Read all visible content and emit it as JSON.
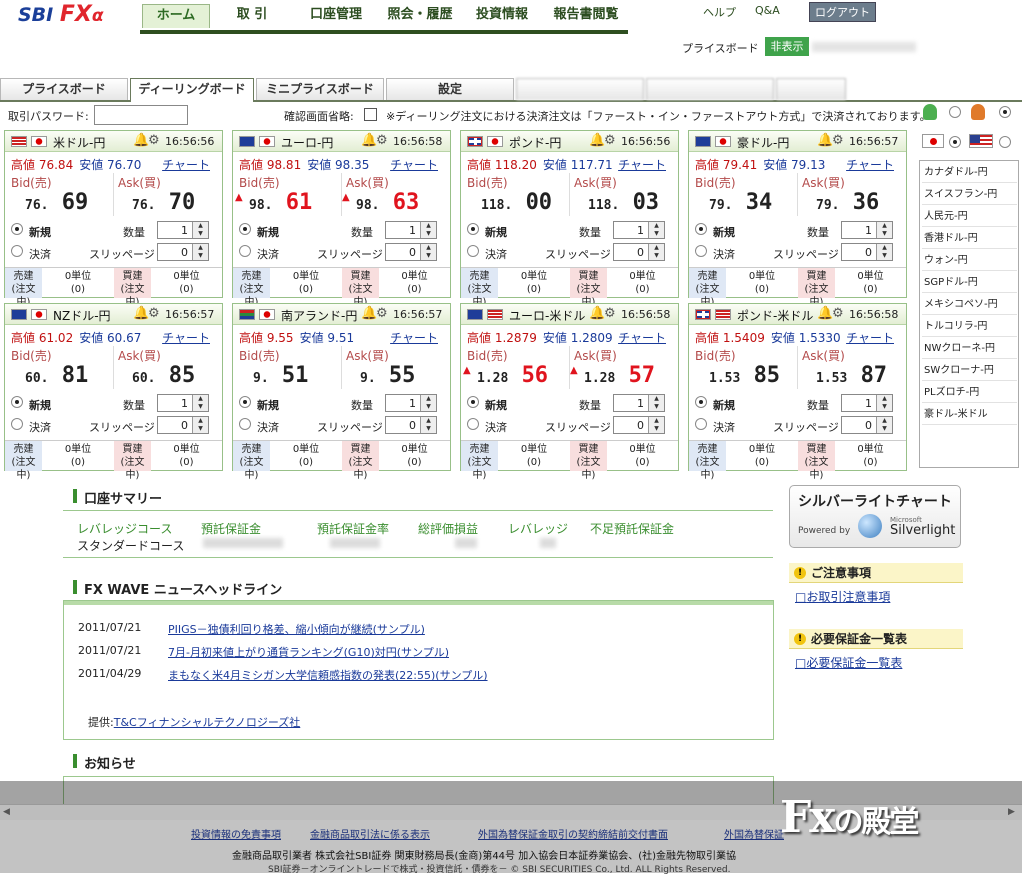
{
  "app": {
    "logo_sbi": "SBI",
    "logo_fx": "FX",
    "logo_alpha": "α"
  },
  "nav": {
    "items": [
      "ホーム",
      "取 引",
      "口座管理",
      "照会・履歴",
      "投資情報",
      "報告書閲覧"
    ],
    "help": "ヘルプ",
    "qa": "Q&A",
    "logout": "ログアウト"
  },
  "priceboard": {
    "label": "プライスボード",
    "hide": "非表示"
  },
  "tabs": [
    "プライスボード",
    "ディーリングボード",
    "ミニプライスボード",
    "設定"
  ],
  "form": {
    "password_label": "取引パスワード:",
    "confirm_label": "確認画面省略:",
    "note": "※ディーリング注文における決済注文は「ファースト・イン・ファーストアウト方式」で決済されております。"
  },
  "labels": {
    "high": "高値",
    "low": "安値",
    "chart": "チャート",
    "bid": "Bid(売)",
    "ask": "Ask(買)",
    "new": "新規",
    "settle": "決済",
    "qty": "数量",
    "slip": "スリッページ",
    "sell_pos": "売建",
    "buy_pos": "買建",
    "ordering": "(注文中)",
    "zero_unit": "0単位",
    "zero_paren": "(0)"
  },
  "panels": [
    {
      "pair": "米ドル-円",
      "time": "16:56:56",
      "high": "76.84",
      "low": "76.70",
      "bid_pre": "76.",
      "bid_big": "69",
      "ask_pre": "76.",
      "ask_big": "70",
      "up": false,
      "qty": "1",
      "slip": "0",
      "flags": [
        "us",
        "jp"
      ]
    },
    {
      "pair": "ユーロ-円",
      "time": "16:56:58",
      "high": "98.81",
      "low": "98.35",
      "bid_pre": "98.",
      "bid_big": "61",
      "ask_pre": "98.",
      "ask_big": "63",
      "up": true,
      "qty": "1",
      "slip": "0",
      "flags": [
        "eu",
        "jp"
      ]
    },
    {
      "pair": "ポンド-円",
      "time": "16:56:56",
      "high": "118.20",
      "low": "117.71",
      "bid_pre": "118.",
      "bid_big": "00",
      "ask_pre": "118.",
      "ask_big": "03",
      "up": false,
      "qty": "1",
      "slip": "0",
      "flags": [
        "gb",
        "jp"
      ]
    },
    {
      "pair": "豪ドル-円",
      "time": "16:56:57",
      "high": "79.41",
      "low": "79.13",
      "bid_pre": "79.",
      "bid_big": "34",
      "ask_pre": "79.",
      "ask_big": "36",
      "up": false,
      "qty": "1",
      "slip": "0",
      "flags": [
        "au",
        "jp"
      ]
    },
    {
      "pair": "NZドル-円",
      "time": "16:56:57",
      "high": "61.02",
      "low": "60.67",
      "bid_pre": "60.",
      "bid_big": "81",
      "ask_pre": "60.",
      "ask_big": "85",
      "up": false,
      "qty": "1",
      "slip": "0",
      "flags": [
        "nz",
        "jp"
      ]
    },
    {
      "pair": "南アランド-円",
      "time": "16:56:57",
      "high": "9.55",
      "low": "9.51",
      "bid_pre": "9.",
      "bid_big": "51",
      "ask_pre": "9.",
      "ask_big": "55",
      "up": false,
      "qty": "1",
      "slip": "0",
      "flags": [
        "za",
        "jp"
      ]
    },
    {
      "pair": "ユーロ-米ドル",
      "time": "16:56:58",
      "high": "1.2879",
      "low": "1.2809",
      "bid_pre": "1.28",
      "bid_big": "56",
      "ask_pre": "1.28",
      "ask_big": "57",
      "up": true,
      "qty": "1",
      "slip": "0",
      "flags": [
        "eu",
        "us"
      ]
    },
    {
      "pair": "ポンド-米ドル",
      "time": "16:56:58",
      "high": "1.5409",
      "low": "1.5330",
      "bid_pre": "1.53",
      "bid_big": "85",
      "ask_pre": "1.53",
      "ask_big": "87",
      "up": false,
      "qty": "1",
      "slip": "0",
      "flags": [
        "gb",
        "us"
      ]
    }
  ],
  "side_list": [
    "カナダドル-円",
    "スイスフラン-円",
    "人民元-円",
    "香港ドル-円",
    "ウォン-円",
    "SGPドル-円",
    "メキシコペソ-円",
    "トルコリラ-円",
    "NWクローネ-円",
    "SWクローナ-円",
    "PLズロチ-円",
    "豪ドル-米ドル"
  ],
  "account": {
    "title": "口座サマリー",
    "cols": [
      "レバレッジコース",
      "預託保証金",
      "預託保証金率",
      "総評価損益",
      "レバレッジ",
      "不足預託保証金"
    ],
    "course": "スタンダードコース"
  },
  "news": {
    "title": "FX WAVE ニュースヘッドライン",
    "items": [
      {
        "date": "2011/07/21",
        "text": "PIIGS－独債利回り格差、縮小傾向が継続(サンプル)"
      },
      {
        "date": "2011/07/21",
        "text": "7月-月初来値上がり通貨ランキング(G10)対円(サンプル)"
      },
      {
        "date": "2011/04/29",
        "text": "まもなく米4月ミシガン大学信頼感指数の発表(22:55)(サンプル)"
      }
    ],
    "credit_label": "提供:",
    "credit_link": "T&Cフィナンシャルテクノロジーズ社"
  },
  "notice": {
    "title": "お知らせ"
  },
  "silverlight": {
    "title": "シルバーライトチャート",
    "powered": "Powered by",
    "ms": "Microsoft",
    "name": "Silverlight"
  },
  "right_boxes": [
    {
      "title": "ご注意事項",
      "link": "お取引注意事項"
    },
    {
      "title": "必要保証金一覧表",
      "link": "必要保証金一覧表"
    }
  ],
  "footer": {
    "links": [
      "投資情報の免責事項",
      "金融商品取引法に係る表示",
      "外国為替保証金取引の契約締結前交付書面",
      "外国為替保証"
    ],
    "line2": "金融商品取引業者 株式会社SBI証券 関東財務局長(金商)第44号 加入協会日本証券業協会、(社)金融先物取引業協",
    "line3": "SBI証券－オンライントレードで株式・投資信託・債券を－ © SBI SECURITIES Co., Ltd. ALL Rights Reserved.",
    "brand": "Fx",
    "brand2": "の殿堂"
  }
}
